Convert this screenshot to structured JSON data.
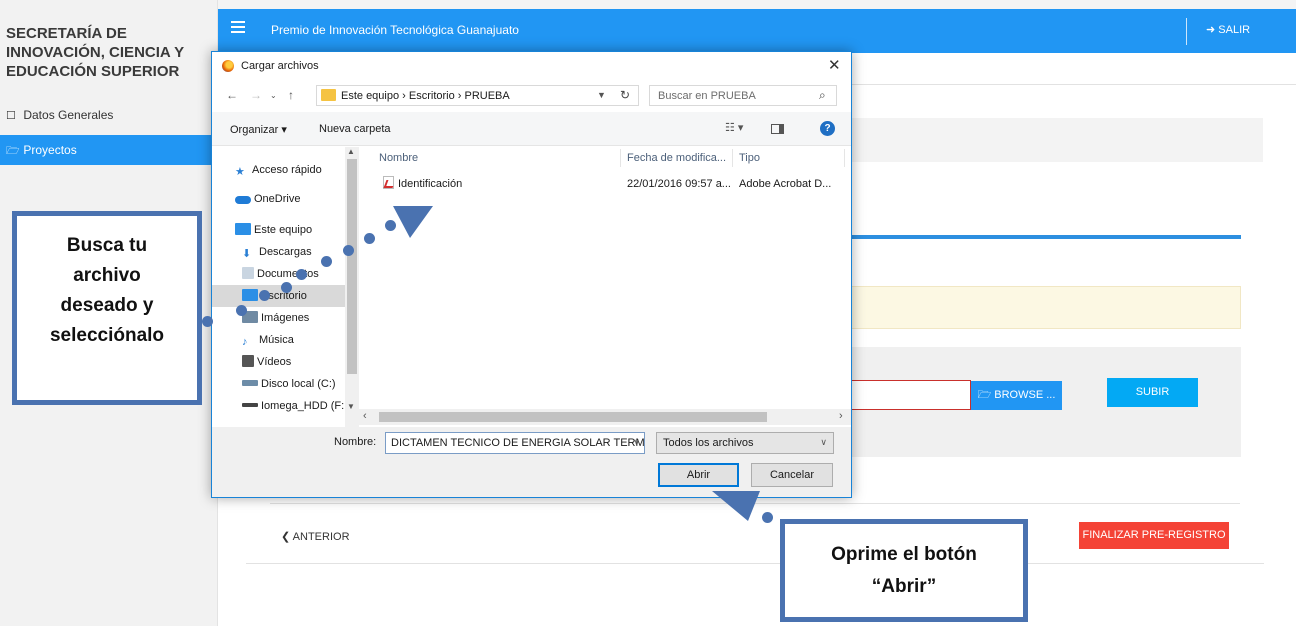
{
  "sidebar": {
    "brand": "SECRETARÍA DE INNOVACIÓN, CIENCIA Y EDUCACIÓN SUPERIOR",
    "items": [
      {
        "label": "Datos Generales"
      },
      {
        "label": "Proyectos",
        "active": true
      }
    ]
  },
  "topbar": {
    "title": "Premio de Innovación Tecnológica Guanajuato",
    "logout": "SALIR",
    "accent": "#2196f3"
  },
  "page": {
    "browse_label": "BROWSE ...",
    "upload_label": "SUBIR",
    "back_label": "ANTERIOR",
    "finish_label": "FINALIZAR PRE-REGISTRO"
  },
  "dialog": {
    "title": "Cargar archivos",
    "breadcrumb": "Este equipo  ›  Escritorio  ›  PRUEBA",
    "search_placeholder": "Buscar en PRUEBA",
    "organize": "Organizar ▾",
    "new_folder": "Nueva carpeta",
    "nav": [
      {
        "label": "Acceso rápido",
        "icon": "star-icon",
        "color": "#2a7fd4"
      },
      {
        "label": "OneDrive",
        "icon": "cloud-icon",
        "color": "#1f7bd6"
      },
      {
        "label": "Este equipo",
        "icon": "computer-icon",
        "color": "#2b8fe6"
      },
      {
        "label": "Descargas",
        "icon": "download-icon",
        "color": "#2a7fd4"
      },
      {
        "label": "Documentos",
        "icon": "document-icon",
        "color": "#8aa1b8"
      },
      {
        "label": "Escritorio",
        "icon": "desktop-icon",
        "color": "#2b8fe6",
        "selected": true
      },
      {
        "label": "Imágenes",
        "icon": "image-icon",
        "color": "#6f8aa3"
      },
      {
        "label": "Música",
        "icon": "music-icon",
        "color": "#2a7fd4"
      },
      {
        "label": "Vídeos",
        "icon": "video-icon",
        "color": "#555555"
      },
      {
        "label": "Disco local (C:)",
        "icon": "drive-icon",
        "color": "#6d8ca8"
      },
      {
        "label": "Iomega_HDD (F:",
        "icon": "drive-icon",
        "color": "#444444"
      }
    ],
    "columns": [
      "Nombre",
      "Fecha de modifica...",
      "Tipo"
    ],
    "files": [
      {
        "name": "Identificación",
        "date": "22/01/2016 09:57 a...",
        "type": "Adobe Acrobat D..."
      }
    ],
    "filename_label": "Nombre:",
    "filename_value": "DICTAMEN TECNICO DE ENERGIA SOLAR TERM",
    "filetype": "Todos los archivos",
    "open": "Abrir",
    "cancel": "Cancelar"
  },
  "callouts": {
    "select_lines": [
      "Busca tu",
      "archivo",
      "deseado y",
      "selecciónalo"
    ],
    "open_lines": [
      "Oprime el botón",
      "“Abrir”"
    ]
  }
}
